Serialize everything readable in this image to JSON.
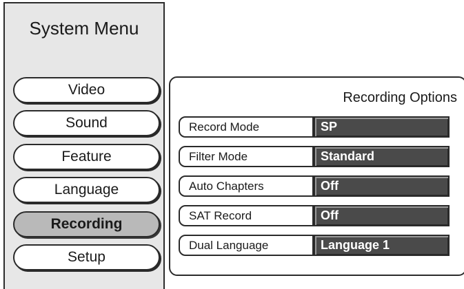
{
  "sidebar": {
    "title": "System Menu",
    "items": [
      {
        "label": "Video"
      },
      {
        "label": "Sound"
      },
      {
        "label": "Feature"
      },
      {
        "label": "Language"
      },
      {
        "label": "Recording",
        "selected": true
      },
      {
        "label": "Setup"
      }
    ]
  },
  "panel": {
    "title": "Recording Options",
    "options": [
      {
        "label": "Record Mode",
        "value": "SP"
      },
      {
        "label": "Filter Mode",
        "value": "Standard"
      },
      {
        "label": "Auto Chapters",
        "value": "Off"
      },
      {
        "label": "SAT Record",
        "value": "Off"
      },
      {
        "label": "Dual Language",
        "value": "Language 1"
      }
    ]
  },
  "colors": {
    "sidebar_bg": "#e7e7e7",
    "selected_bg": "#b9b9b9",
    "value_bg": "#4a4a4a"
  }
}
